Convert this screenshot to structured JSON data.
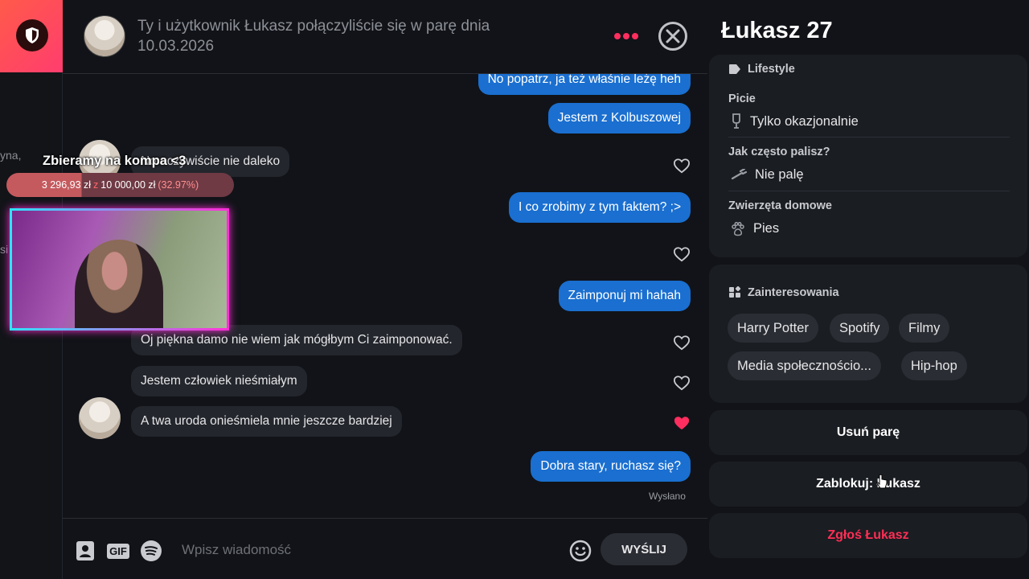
{
  "left": {
    "fragments": [
      "yna,",
      "si"
    ]
  },
  "chat": {
    "header": {
      "text": "Ty i użytkownik Łukasz połączyliście się w parę dnia 10.03.2026"
    },
    "messages": [
      {
        "dir": "out",
        "text": "No popatrz, ja też właśnie leżę heh"
      },
      {
        "dir": "out",
        "text": "Jestem z Kolbuszowej"
      },
      {
        "dir": "in",
        "text": "No oczywiście nie daleko",
        "liked": false
      },
      {
        "dir": "out",
        "text": "I co zrobimy z tym faktem? ;>"
      },
      {
        "dir": "in",
        "text": "",
        "liked": false
      },
      {
        "dir": "out",
        "text": "Zaimponuj mi hahah"
      },
      {
        "dir": "in",
        "text": "Oj piękna damo nie wiem jak mógłbym Ci zaimponować.",
        "liked": false
      },
      {
        "dir": "in",
        "text": "Jestem człowiek nieśmiałym",
        "liked": false
      },
      {
        "dir": "in",
        "text": "A twa uroda onieśmiela mnie jeszcze bardziej",
        "liked": true
      },
      {
        "dir": "out",
        "text": "Dobra stary, ruchasz się?"
      }
    ],
    "sent_label": "Wysłano",
    "composer": {
      "placeholder": "Wpisz wiadomość",
      "gif_label": "GIF",
      "send_label": "WYŚLIJ"
    }
  },
  "overlay": {
    "title": "Zbieramy na kompa <3",
    "raised": "3 296,93 zł",
    "separator": "z",
    "goal": "10 000,00 zł",
    "percent_label": "(32.97%)",
    "progress": 0.3297
  },
  "profile": {
    "name": "Łukasz 27",
    "lifestyle": {
      "title": "Lifestyle",
      "rows": [
        {
          "label": "Picie",
          "value": "Tylko okazjonalnie",
          "icon": "glass-icon"
        },
        {
          "label": "Jak często palisz?",
          "value": "Nie palę",
          "icon": "cigarette-icon"
        },
        {
          "label": "Zwierzęta domowe",
          "value": "Pies",
          "icon": "paw-icon"
        }
      ]
    },
    "interests": {
      "title": "Zainteresowania",
      "chips": [
        "Harry Potter",
        "Spotify",
        "Filmy",
        "Media społecznościo...",
        "Hip-hop"
      ]
    },
    "actions": {
      "remove": "Usuń parę",
      "block": "Zablokuj: Łukasz",
      "report": "Zgłoś Łukasz"
    }
  },
  "colors": {
    "accent": "#ff2e5f",
    "bubble_out": "#1a6fd0",
    "bubble_in": "#23262c",
    "danger": "#ff2e55"
  }
}
